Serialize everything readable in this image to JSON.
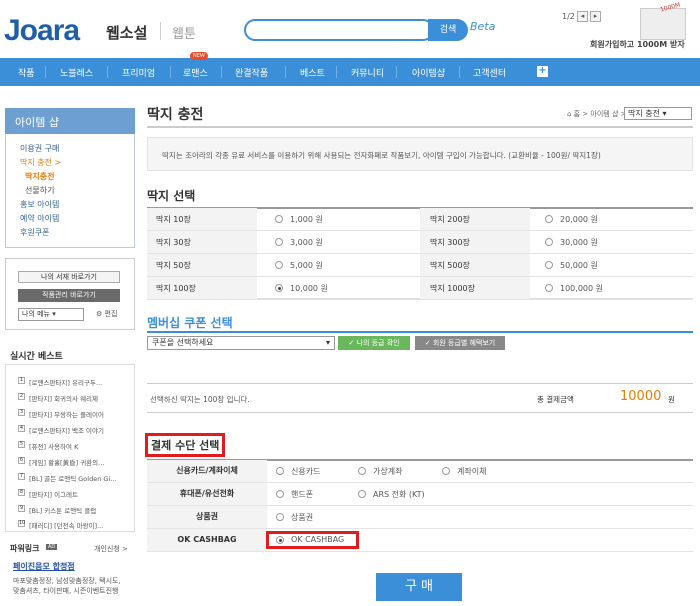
{
  "header": {
    "logo": "Joara",
    "site_title": "웹소설",
    "webtoon": "웹툰",
    "search_label": "검색",
    "beta": "Beta",
    "page_count": "1/2",
    "promo_text": "회원가입하고 1000M 받자",
    "promo_badge": "1000M"
  },
  "nav": {
    "items": [
      "작품",
      "노블레스",
      "프리미엄",
      "로맨스",
      "완결작품",
      "베스트",
      "커뮤니티",
      "아이템샵",
      "고객센터"
    ],
    "new_badge": "NEW"
  },
  "sidebar": {
    "title": "아이템 샵",
    "menu": [
      "이용권 구매",
      "딱지 충전 >",
      "딱지충전",
      "선물하기",
      "홍보 아이템",
      "예약 아이템",
      "후원쿠폰"
    ],
    "btn_mylib": "나의 서재 바로가기",
    "btn_works": "작품관리 바로가기",
    "select_menu": "나의 메뉴",
    "edit": "편집",
    "realtime_title": "실시간 베스트",
    "realtime": [
      "[로맨스판타지] 유리구두...",
      "[판타지] 회귀의사 웨리제",
      "[판타지] 무쌍하는 플레이어",
      "[로맨스판타지] 백조 이야기",
      "[퓨전] 사용하여 K",
      "[게임] 황홀[黃昏] 귀환의...",
      "[BL] 골든 로맨틱 Golden Gi...",
      "[판타지] 이그레트",
      "[BL] 키스툰 로맨틱 클럽",
      "[패러디] [던전속 마왕이]..."
    ],
    "powerlink_title": "파워링크",
    "ad": "AD",
    "apply": "개인신청 >",
    "pl_link": "페이진음모 합정점",
    "pl_desc": "마포맞춤정장, 남성맞춤정장, 택시도, 맞춤셔츠, 타이판매, 시즌이벤트진행"
  },
  "main": {
    "title": "딱지 충전",
    "breadcrumb": "홈 > 아이템 샵 >",
    "breadcrumb_select": "딱지 충전",
    "info": "딱지는 조아라의 각종 유료 서비스를 이용하기 위해 사용되는 전자화폐로 작품보기, 아이템 구입이 가능합니다. (교환비율 - 100원/ 딱지1장)",
    "select_title": "딱지 선택",
    "options": [
      {
        "label": "딱지 10장",
        "price": "1,000 원",
        "label2": "딱지 200장",
        "price2": "20,000 원"
      },
      {
        "label": "딱지 30장",
        "price": "3,000 원",
        "label2": "딱지 300장",
        "price2": "30,000 원"
      },
      {
        "label": "딱지 50장",
        "price": "5,000 원",
        "label2": "딱지 500장",
        "price2": "50,000 원"
      },
      {
        "label": "딱지 100장",
        "price": "10,000 원",
        "label2": "딱지 1000장",
        "price2": "100,000 원"
      }
    ],
    "coupon_title": "멤버십 쿠폰 선택",
    "coupon_placeholder": "쿠폰을 선택하세요",
    "btn_grade": "나의 등급 확인",
    "btn_benefit": "회원 등급별 혜택보기",
    "sum_msg": "선택하신 딱지는 100장 입니다.",
    "sum_label": "총 결제금액",
    "sum_amount": "10000",
    "sum_unit": "원",
    "pay_title": "결제 수단 선택",
    "pay_rows": [
      {
        "label": "신용카드/계좌이체",
        "opts": [
          "신용카드",
          "가상계좌",
          "계좌이체"
        ]
      },
      {
        "label": "휴대폰/유선전화",
        "opts": [
          "핸드폰",
          "ARS 전화 (KT)"
        ]
      },
      {
        "label": "상품권",
        "opts": [
          "상품권"
        ]
      },
      {
        "label": "OK CASHBAG",
        "opts": [
          "OK CASHBAG"
        ]
      }
    ],
    "buy": "구 매"
  }
}
